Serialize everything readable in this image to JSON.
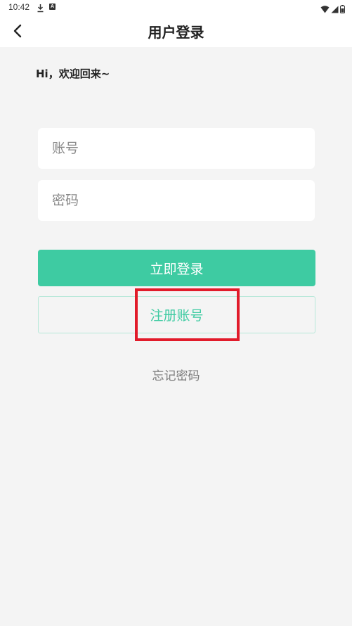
{
  "status_bar": {
    "time": "10:42",
    "badge": "A"
  },
  "header": {
    "title": "用户登录",
    "back_icon": "chevron-left-icon"
  },
  "welcome": "Hi，欢迎回来~",
  "form": {
    "account_placeholder": "账号",
    "password_placeholder": "密码",
    "login_label": "立即登录",
    "register_label": "注册账号",
    "forgot_label": "忘记密码"
  },
  "colors": {
    "accent": "#3ecba2",
    "background": "#f4f4f4",
    "highlight": "#e11b2a"
  }
}
